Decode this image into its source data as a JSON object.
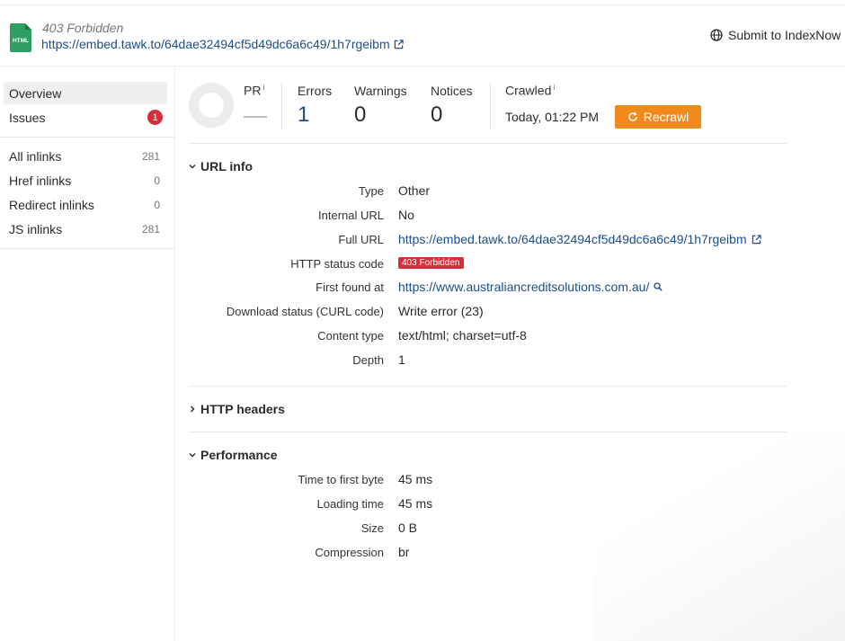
{
  "header": {
    "file_type_icon": "html-file-icon",
    "status_title": "403 Forbidden",
    "url": "https://embed.tawk.to/64dae32494cf5d49dc6a6c49/1h7rgeibm",
    "submit_label": "Submit to IndexNow"
  },
  "sidebar": {
    "items": [
      {
        "label": "Overview"
      },
      {
        "label": "Issues",
        "badge": "1"
      },
      {
        "label": "All inlinks",
        "count": "281"
      },
      {
        "label": "Href inlinks",
        "count": "0"
      },
      {
        "label": "Redirect inlinks",
        "count": "0"
      },
      {
        "label": "JS inlinks",
        "count": "281"
      }
    ]
  },
  "stats": {
    "pr_label": "PR",
    "info_marker": "i",
    "errors_label": "Errors",
    "errors_value": "1",
    "warnings_label": "Warnings",
    "warnings_value": "0",
    "notices_label": "Notices",
    "notices_value": "0",
    "crawled_label": "Crawled",
    "crawled_value": "Today, 01:22 PM",
    "recrawl_label": "Recrawl"
  },
  "url_info": {
    "title": "URL info",
    "rows": [
      {
        "label": "Type",
        "value": "Other"
      },
      {
        "label": "Internal URL",
        "value": "No"
      },
      {
        "label": "Full URL",
        "value": "https://embed.tawk.to/64dae32494cf5d49dc6a6c49/1h7rgeibm"
      },
      {
        "label": "HTTP status code",
        "value": "403 Forbidden"
      },
      {
        "label": "First found at",
        "value": "https://www.australiancreditsolutions.com.au/"
      },
      {
        "label": "Download status (CURL code)",
        "value": "Write error (23)"
      },
      {
        "label": "Content type",
        "value": "text/html; charset=utf-8"
      },
      {
        "label": "Depth",
        "value": "1"
      }
    ]
  },
  "http_headers": {
    "title": "HTTP headers"
  },
  "performance": {
    "title": "Performance",
    "rows": [
      {
        "label": "Time to first byte",
        "value": "45 ms"
      },
      {
        "label": "Loading time",
        "value": "45 ms"
      },
      {
        "label": "Size",
        "value": "0 B"
      },
      {
        "label": "Compression",
        "value": "br"
      }
    ]
  },
  "colors": {
    "link": "#1a4f8b",
    "accent": "#f08a1c",
    "error": "#d62f3c",
    "file_icon": "#2e9e63"
  }
}
